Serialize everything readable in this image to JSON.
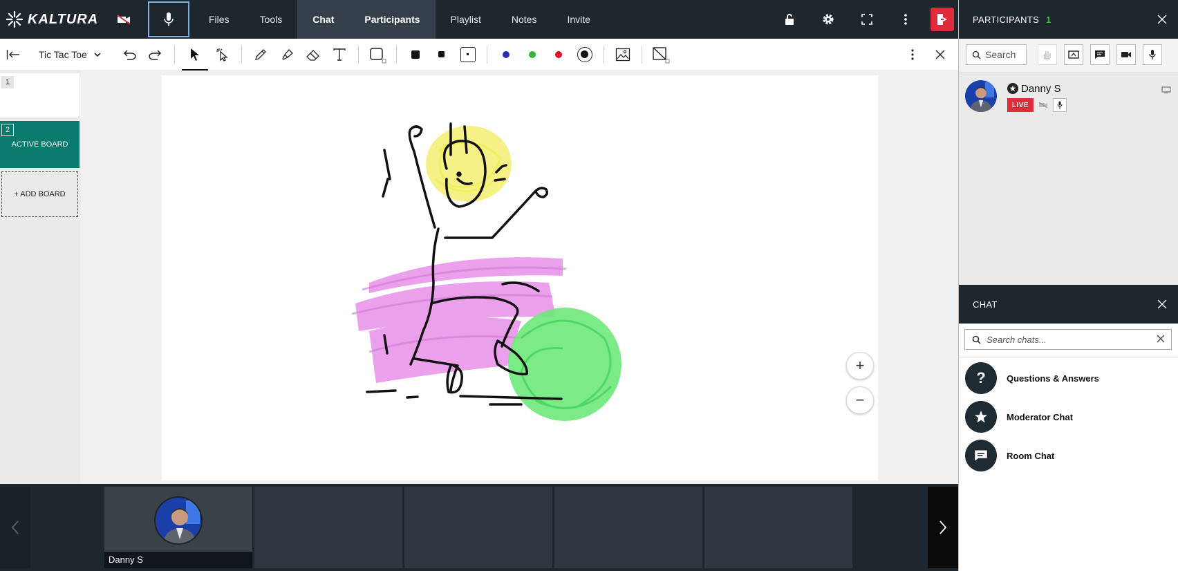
{
  "app": {
    "brand": "KALTURA"
  },
  "topbar": {
    "tabs": [
      {
        "label": "Files"
      },
      {
        "label": "Tools"
      },
      {
        "label": "Chat"
      },
      {
        "label": "Participants"
      },
      {
        "label": "Playlist"
      },
      {
        "label": "Notes"
      },
      {
        "label": "Invite"
      }
    ],
    "active_tabs": [
      "Chat",
      "Participants"
    ]
  },
  "whiteboard": {
    "board_name": "Tic Tac Toe",
    "colors": {
      "blue": "#2b2bb8",
      "green": "#36b536",
      "red": "#e0122a"
    }
  },
  "boards": {
    "items": [
      {
        "number": "1",
        "caption": ""
      },
      {
        "number": "2",
        "caption": "ACTIVE BOARD"
      }
    ],
    "add_label": "+ ADD BOARD"
  },
  "zoom": {
    "in_label": "+",
    "out_label": "−"
  },
  "filmstrip": {
    "user_name": "Danny S"
  },
  "participants": {
    "title": "PARTICIPANTS",
    "count": "1",
    "search_placeholder": "Search",
    "users": [
      {
        "name": "Danny S",
        "live_label": "LIVE"
      }
    ]
  },
  "chat": {
    "title": "CHAT",
    "search_placeholder": "Search chats...",
    "rooms": [
      {
        "label": "Questions & Answers",
        "icon": "question-icon"
      },
      {
        "label": "Moderator Chat",
        "icon": "star-icon"
      },
      {
        "label": "Room Chat",
        "icon": "chat-bubble-icon"
      }
    ]
  },
  "accent": {
    "teal": "#0a7a6e",
    "exit_red": "#e02b3a",
    "topbar": "#1e262e"
  }
}
